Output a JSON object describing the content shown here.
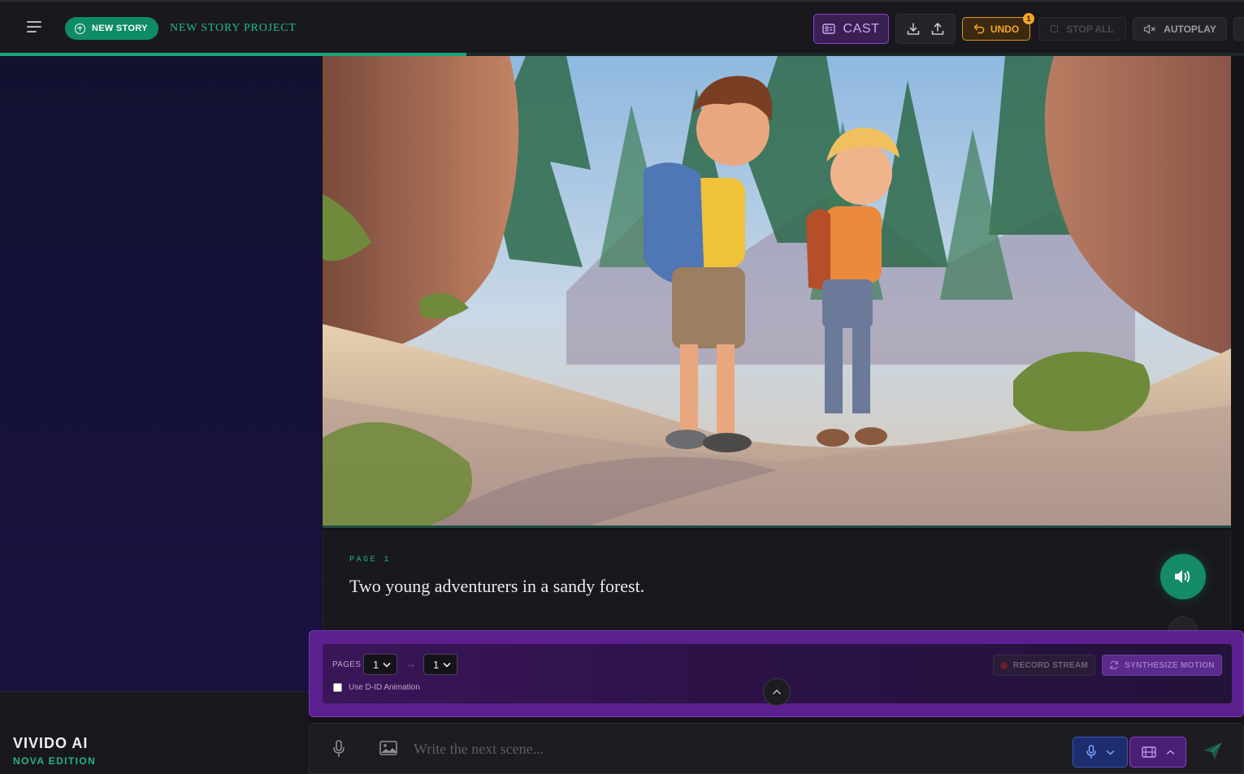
{
  "topbar": {
    "new_story_label": "NEW STORY",
    "project_title": "NEW STORY PROJECT",
    "cast_label": "CAST",
    "undo_label": "UNDO",
    "undo_count": "1",
    "stop_all_label": "STOP ALL",
    "autoplay_label": "AUTOPLAY",
    "progress_fraction": 0.375
  },
  "brand": {
    "name": "VIVIDO AI",
    "edition": "NOVA EDITION"
  },
  "page": {
    "label": "PAGE 1",
    "text": "Two young adventurers in a sandy forest."
  },
  "tools": {
    "pages_label": "PAGES",
    "page_from": "1",
    "page_to": "1",
    "did_label": "Use D-ID Animation",
    "did_checked": false,
    "record_label": "RECORD STREAM",
    "synth_label": "SYNTHESIZE MOTION"
  },
  "composer": {
    "placeholder": "Write the next scene..."
  },
  "colors": {
    "accent_green": "#0e8c65",
    "accent_purple": "#8a3fd0",
    "accent_orange": "#f5a524"
  }
}
